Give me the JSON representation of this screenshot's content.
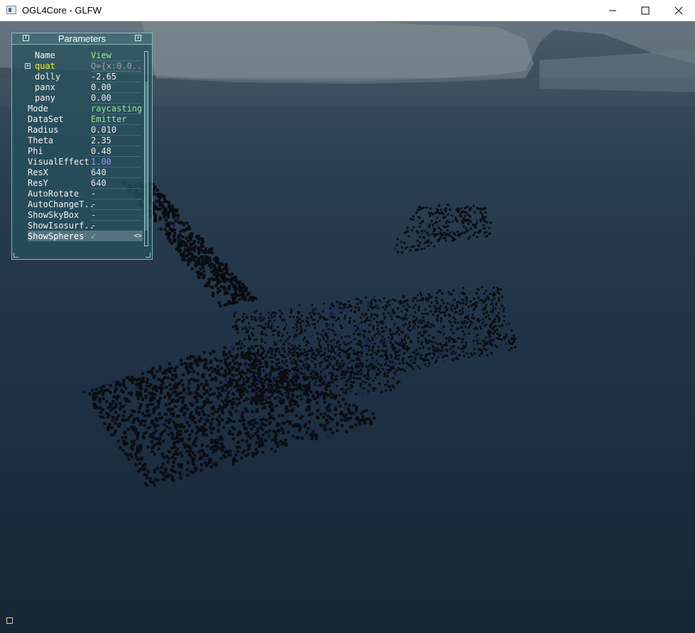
{
  "window": {
    "title": "OGL4Core - GLFW",
    "minimize_icon": "minimize-icon",
    "maximize_icon": "maximize-icon",
    "close_icon": "close-icon"
  },
  "panel": {
    "title": "Parameters",
    "rows": [
      {
        "label": "Name",
        "value": "View",
        "value_color": "#9be59b",
        "label_color": "#f2f2f2",
        "child": true
      },
      {
        "label": "quat",
        "value": "Q={x:0.0..",
        "value_color": "#9aa4a8",
        "label_color": "#f0f030",
        "child": true,
        "expander": "+"
      },
      {
        "label": "dolly",
        "value": "-2.65",
        "value_color": "#e8e8e8",
        "label_color": "#f2f2f2",
        "child": true
      },
      {
        "label": "panx",
        "value": "0.00",
        "value_color": "#e8e8e8",
        "label_color": "#f2f2f2",
        "child": true
      },
      {
        "label": "pany",
        "value": "0.00",
        "value_color": "#e8e8e8",
        "label_color": "#f2f2f2",
        "child": true
      },
      {
        "label": "Mode",
        "value": "raycasting",
        "value_color": "#9be59b",
        "label_color": "#f2f2f2"
      },
      {
        "label": "DataSet",
        "value": "Emitter",
        "value_color": "#9be59b",
        "label_color": "#f2f2f2"
      },
      {
        "label": "Radius",
        "value": "0.010",
        "value_color": "#e8e8e8",
        "label_color": "#f2f2f2"
      },
      {
        "label": "Theta",
        "value": "2.35",
        "value_color": "#e8e8e8",
        "label_color": "#f2f2f2"
      },
      {
        "label": "Phi",
        "value": "0.48",
        "value_color": "#e8e8e8",
        "label_color": "#f2f2f2"
      },
      {
        "label": "VisualEffect",
        "value": "1.00",
        "value_color": "#9a9aff",
        "label_color": "#f2f2f2"
      },
      {
        "label": "ResX",
        "value": "640",
        "value_color": "#e8e8e8",
        "label_color": "#f2f2f2"
      },
      {
        "label": "ResY",
        "value": "640",
        "value_color": "#e8e8e8",
        "label_color": "#f2f2f2"
      },
      {
        "label": "AutoRotate",
        "value": "-",
        "value_color": "#e8e8e8",
        "label_color": "#f2f2f2"
      },
      {
        "label": "AutoChangeT..",
        "value": "-",
        "value_color": "#e8e8e8",
        "label_color": "#f2f2f2"
      },
      {
        "label": "ShowSkyBox",
        "value": "-",
        "value_color": "#e8e8e8",
        "label_color": "#f2f2f2"
      },
      {
        "label": "ShowIsosurf..",
        "value": "-",
        "value_color": "#e8e8e8",
        "label_color": "#f2f2f2"
      },
      {
        "label": "ShowSpheres",
        "value": "✓",
        "value_color": "#7ee07e",
        "label_color": "#ffffff",
        "selected": true,
        "arrows": "<>"
      }
    ]
  }
}
